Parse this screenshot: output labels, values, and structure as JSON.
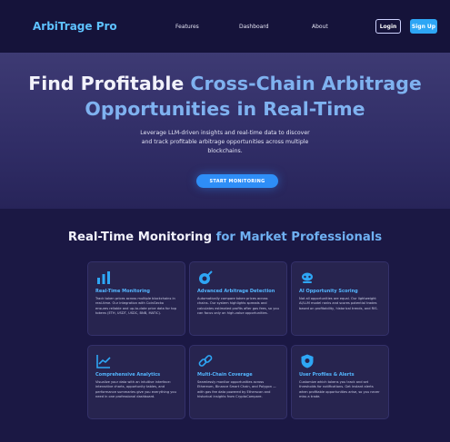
{
  "nav": {
    "brand": "ArbiTrage Pro",
    "links": [
      "Features",
      "Dashboard",
      "About"
    ],
    "login_label": "Login",
    "signup_label": "Sign Up"
  },
  "hero": {
    "title_line1_part1": "Find Profitable ",
    "title_line1_part2": "Cross-Chain Arbitrage",
    "title_line2": "Opportunities in Real-Time",
    "subtitle": "Leverage LLM-driven insights and real-time data to discover and track profitable arbitrage opportunities across multiple blockchains.",
    "cta_label": "START MONITORING"
  },
  "features": {
    "title_part1": "Real-Time Monitoring ",
    "title_part2": "for Market Professionals",
    "cards": [
      {
        "icon": "bar-chart-icon",
        "title": "Real-Time Monitoring",
        "text": "Track token prices across multiple blockchains in real-time. Our integration with CoinGecko ensures reliable and up-to-date price data for top tokens (ETH, USDT, USDC, BNB, MATIC)."
      },
      {
        "icon": "target-icon",
        "title": "Advanced Arbitrage Detection",
        "text": "Automatically compare token prices across chains. Our system highlights spreads and calculates estimated profits after gas fees, so you can focus only on high-value opportunities."
      },
      {
        "icon": "ai-brain-icon",
        "title": "AI Opportunity Scoring",
        "text": "Not all opportunities are equal. Our lightweight AI/LLM model ranks and scores potential trades based on profitability, historical trends, and RIS."
      },
      {
        "icon": "line-chart-icon",
        "title": "Comprehensive Analytics",
        "text": "Visualize your data with an intuitive interface: interactive charts, opportunity tables, and performance summaries give you everything you need in one professional dashboard."
      },
      {
        "icon": "link-icon",
        "title": "Multi-Chain Coverage",
        "text": "Seamlessly monitor opportunities across Ethereum, Binance Smart Chain, and Polygon — with gas fee data powered by Etherscan and historical insights from CryptoCompare."
      },
      {
        "icon": "shield-icon",
        "title": "User Profiles & Alerts",
        "text": "Customize which tokens you track and set thresholds for notifications. Get instant alerts when profitable opportunities arise, so you never miss a trade."
      }
    ]
  },
  "colors": {
    "accent": "#2e8ef7",
    "brand": "#5ec2ff",
    "card_title": "#54b6ff",
    "background": "#1b1844"
  }
}
